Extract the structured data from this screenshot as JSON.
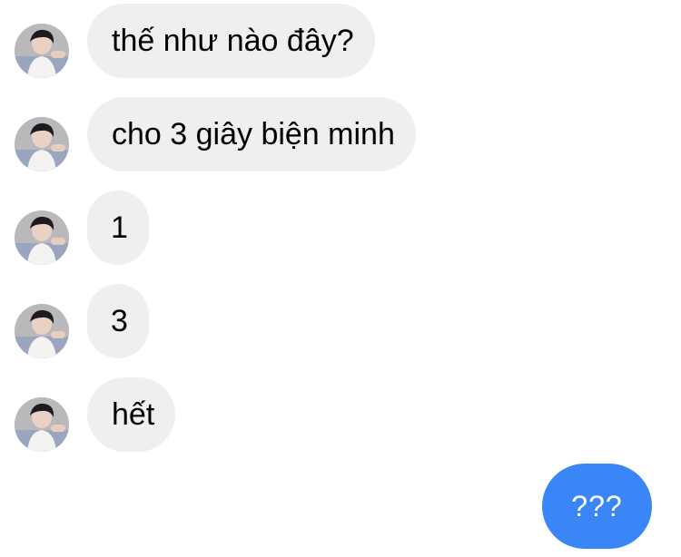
{
  "messages": [
    {
      "text": "thế như nào đây?",
      "sender": "other"
    },
    {
      "text": "cho 3 giây biện minh",
      "sender": "other"
    },
    {
      "text": "1",
      "sender": "other"
    },
    {
      "text": "3",
      "sender": "other"
    },
    {
      "text": "hết",
      "sender": "other"
    }
  ],
  "sent_message": {
    "text": "???",
    "sender": "me"
  },
  "colors": {
    "received_bubble": "#efeff0",
    "sent_bubble": "#3a86f6",
    "received_text": "#000000",
    "sent_text": "#ffffff"
  },
  "icons": {
    "avatar": "contact-avatar-photo"
  }
}
